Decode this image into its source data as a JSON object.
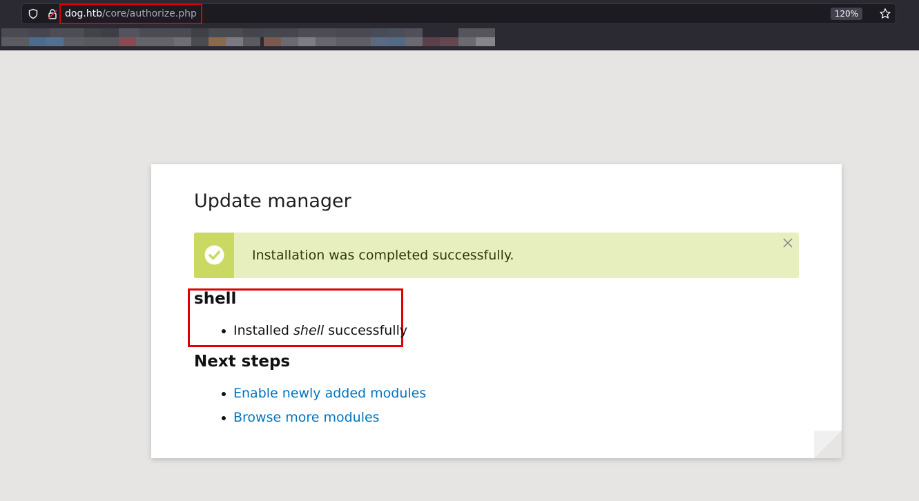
{
  "browser": {
    "url_host": "dog.htb",
    "url_path": "/core/authorize.php",
    "zoom": "120%",
    "icons": {
      "shield": "shield-icon",
      "lock": "lock-warning-icon",
      "bookmark": "star-icon"
    }
  },
  "page": {
    "title": "Update manager",
    "status": {
      "type": "success",
      "message": "Installation was completed successfully.",
      "icon": "check-circle-icon",
      "close_icon": "close-icon",
      "colors": {
        "background": "#e8efbf",
        "icon_background": "#c9d961",
        "text": "#2a3b06"
      }
    },
    "module": {
      "name": "shell",
      "result_prefix": "Installed",
      "result_module": "shell",
      "result_suffix": "successfully"
    },
    "next_steps": {
      "heading": "Next steps",
      "links": [
        {
          "label": "Enable newly added modules"
        },
        {
          "label": "Browse more modules"
        }
      ]
    },
    "colors": {
      "link": "#0074bd",
      "highlight_box": "#e00000"
    }
  }
}
